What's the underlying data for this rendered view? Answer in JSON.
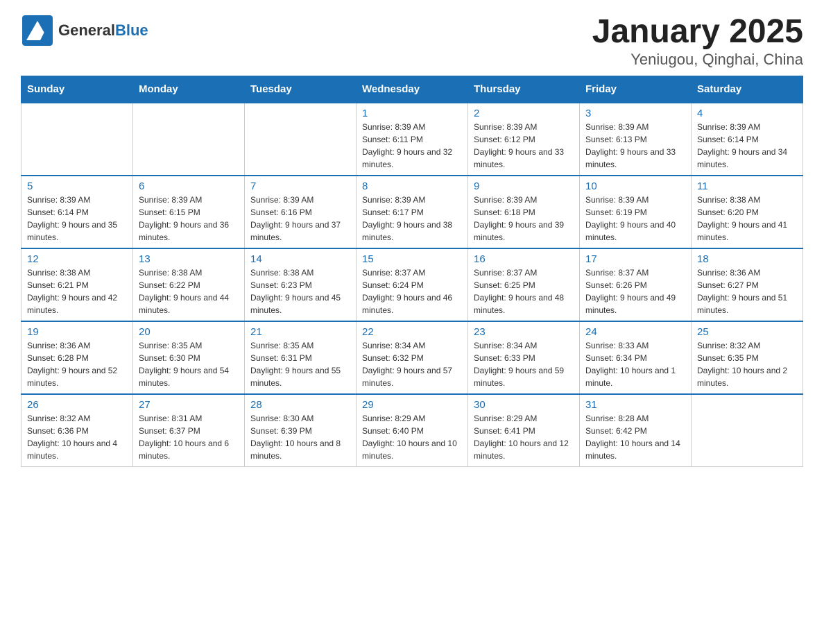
{
  "logo": {
    "general": "General",
    "blue": "Blue"
  },
  "title": "January 2025",
  "subtitle": "Yeniugou, Qinghai, China",
  "days_of_week": [
    "Sunday",
    "Monday",
    "Tuesday",
    "Wednesday",
    "Thursday",
    "Friday",
    "Saturday"
  ],
  "weeks": [
    [
      {
        "day": "",
        "info": ""
      },
      {
        "day": "",
        "info": ""
      },
      {
        "day": "",
        "info": ""
      },
      {
        "day": "1",
        "info": "Sunrise: 8:39 AM\nSunset: 6:11 PM\nDaylight: 9 hours and 32 minutes."
      },
      {
        "day": "2",
        "info": "Sunrise: 8:39 AM\nSunset: 6:12 PM\nDaylight: 9 hours and 33 minutes."
      },
      {
        "day": "3",
        "info": "Sunrise: 8:39 AM\nSunset: 6:13 PM\nDaylight: 9 hours and 33 minutes."
      },
      {
        "day": "4",
        "info": "Sunrise: 8:39 AM\nSunset: 6:14 PM\nDaylight: 9 hours and 34 minutes."
      }
    ],
    [
      {
        "day": "5",
        "info": "Sunrise: 8:39 AM\nSunset: 6:14 PM\nDaylight: 9 hours and 35 minutes."
      },
      {
        "day": "6",
        "info": "Sunrise: 8:39 AM\nSunset: 6:15 PM\nDaylight: 9 hours and 36 minutes."
      },
      {
        "day": "7",
        "info": "Sunrise: 8:39 AM\nSunset: 6:16 PM\nDaylight: 9 hours and 37 minutes."
      },
      {
        "day": "8",
        "info": "Sunrise: 8:39 AM\nSunset: 6:17 PM\nDaylight: 9 hours and 38 minutes."
      },
      {
        "day": "9",
        "info": "Sunrise: 8:39 AM\nSunset: 6:18 PM\nDaylight: 9 hours and 39 minutes."
      },
      {
        "day": "10",
        "info": "Sunrise: 8:39 AM\nSunset: 6:19 PM\nDaylight: 9 hours and 40 minutes."
      },
      {
        "day": "11",
        "info": "Sunrise: 8:38 AM\nSunset: 6:20 PM\nDaylight: 9 hours and 41 minutes."
      }
    ],
    [
      {
        "day": "12",
        "info": "Sunrise: 8:38 AM\nSunset: 6:21 PM\nDaylight: 9 hours and 42 minutes."
      },
      {
        "day": "13",
        "info": "Sunrise: 8:38 AM\nSunset: 6:22 PM\nDaylight: 9 hours and 44 minutes."
      },
      {
        "day": "14",
        "info": "Sunrise: 8:38 AM\nSunset: 6:23 PM\nDaylight: 9 hours and 45 minutes."
      },
      {
        "day": "15",
        "info": "Sunrise: 8:37 AM\nSunset: 6:24 PM\nDaylight: 9 hours and 46 minutes."
      },
      {
        "day": "16",
        "info": "Sunrise: 8:37 AM\nSunset: 6:25 PM\nDaylight: 9 hours and 48 minutes."
      },
      {
        "day": "17",
        "info": "Sunrise: 8:37 AM\nSunset: 6:26 PM\nDaylight: 9 hours and 49 minutes."
      },
      {
        "day": "18",
        "info": "Sunrise: 8:36 AM\nSunset: 6:27 PM\nDaylight: 9 hours and 51 minutes."
      }
    ],
    [
      {
        "day": "19",
        "info": "Sunrise: 8:36 AM\nSunset: 6:28 PM\nDaylight: 9 hours and 52 minutes."
      },
      {
        "day": "20",
        "info": "Sunrise: 8:35 AM\nSunset: 6:30 PM\nDaylight: 9 hours and 54 minutes."
      },
      {
        "day": "21",
        "info": "Sunrise: 8:35 AM\nSunset: 6:31 PM\nDaylight: 9 hours and 55 minutes."
      },
      {
        "day": "22",
        "info": "Sunrise: 8:34 AM\nSunset: 6:32 PM\nDaylight: 9 hours and 57 minutes."
      },
      {
        "day": "23",
        "info": "Sunrise: 8:34 AM\nSunset: 6:33 PM\nDaylight: 9 hours and 59 minutes."
      },
      {
        "day": "24",
        "info": "Sunrise: 8:33 AM\nSunset: 6:34 PM\nDaylight: 10 hours and 1 minute."
      },
      {
        "day": "25",
        "info": "Sunrise: 8:32 AM\nSunset: 6:35 PM\nDaylight: 10 hours and 2 minutes."
      }
    ],
    [
      {
        "day": "26",
        "info": "Sunrise: 8:32 AM\nSunset: 6:36 PM\nDaylight: 10 hours and 4 minutes."
      },
      {
        "day": "27",
        "info": "Sunrise: 8:31 AM\nSunset: 6:37 PM\nDaylight: 10 hours and 6 minutes."
      },
      {
        "day": "28",
        "info": "Sunrise: 8:30 AM\nSunset: 6:39 PM\nDaylight: 10 hours and 8 minutes."
      },
      {
        "day": "29",
        "info": "Sunrise: 8:29 AM\nSunset: 6:40 PM\nDaylight: 10 hours and 10 minutes."
      },
      {
        "day": "30",
        "info": "Sunrise: 8:29 AM\nSunset: 6:41 PM\nDaylight: 10 hours and 12 minutes."
      },
      {
        "day": "31",
        "info": "Sunrise: 8:28 AM\nSunset: 6:42 PM\nDaylight: 10 hours and 14 minutes."
      },
      {
        "day": "",
        "info": ""
      }
    ]
  ]
}
